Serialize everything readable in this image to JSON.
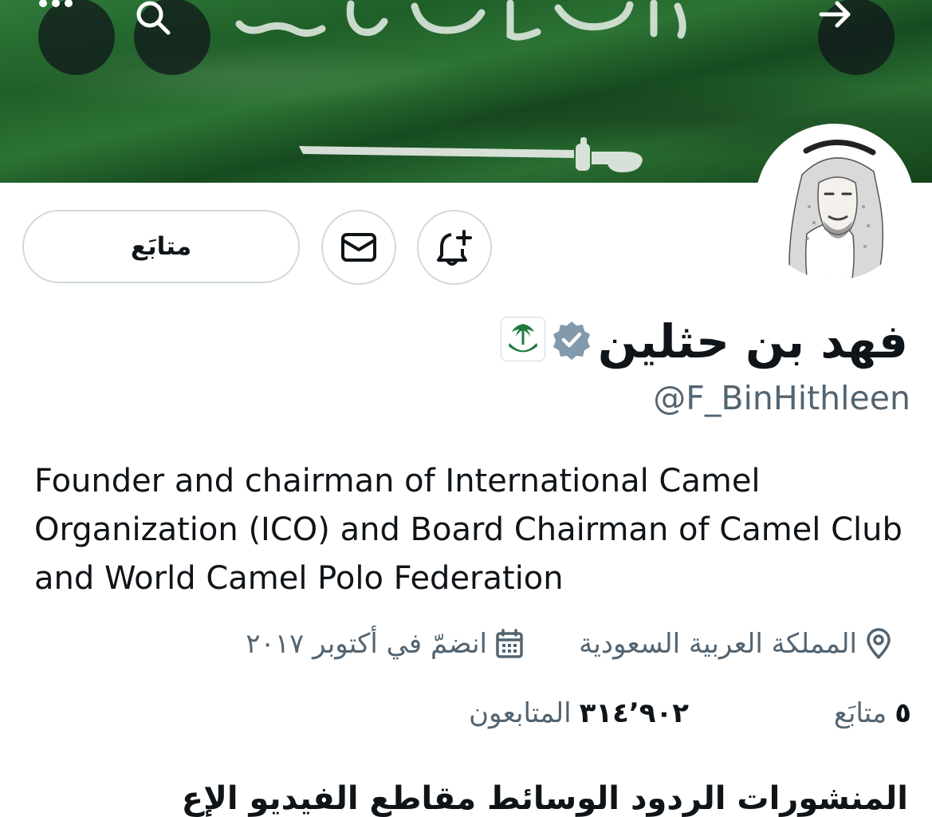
{
  "banner": {
    "description_icon": "saudi-flag-banner",
    "back_button_icon": "arrow-right-icon",
    "search_button_icon": "search-icon",
    "more_button_icon": "more-horizontal-icon"
  },
  "profile": {
    "display_name": "فهد بن حثلين",
    "handle": "@F_BinHithleen",
    "verified_icon": "verified-badge-icon",
    "affiliate_icon": "saudi-emblem-icon",
    "bio": "Founder and chairman of International Camel Organization (ICO) and Board Chairman of Camel Club and World Camel Polo Federation",
    "location": "المملكة العربية السعودية",
    "joined": "انضمّ في أكتوبر ٢٠١٧"
  },
  "actions": {
    "follow_label": "متابَع",
    "message_icon": "mail-icon",
    "notify_icon": "bell-plus-icon"
  },
  "stats": {
    "following_count": "٥",
    "following_label": "متابَع",
    "followers_count": "٣١٤٬٩٠٢",
    "followers_label": "المتابعون"
  },
  "next_section_partial": "المنشورات   الردود   الوسائط   مقاطع الفيديو   الإع"
}
